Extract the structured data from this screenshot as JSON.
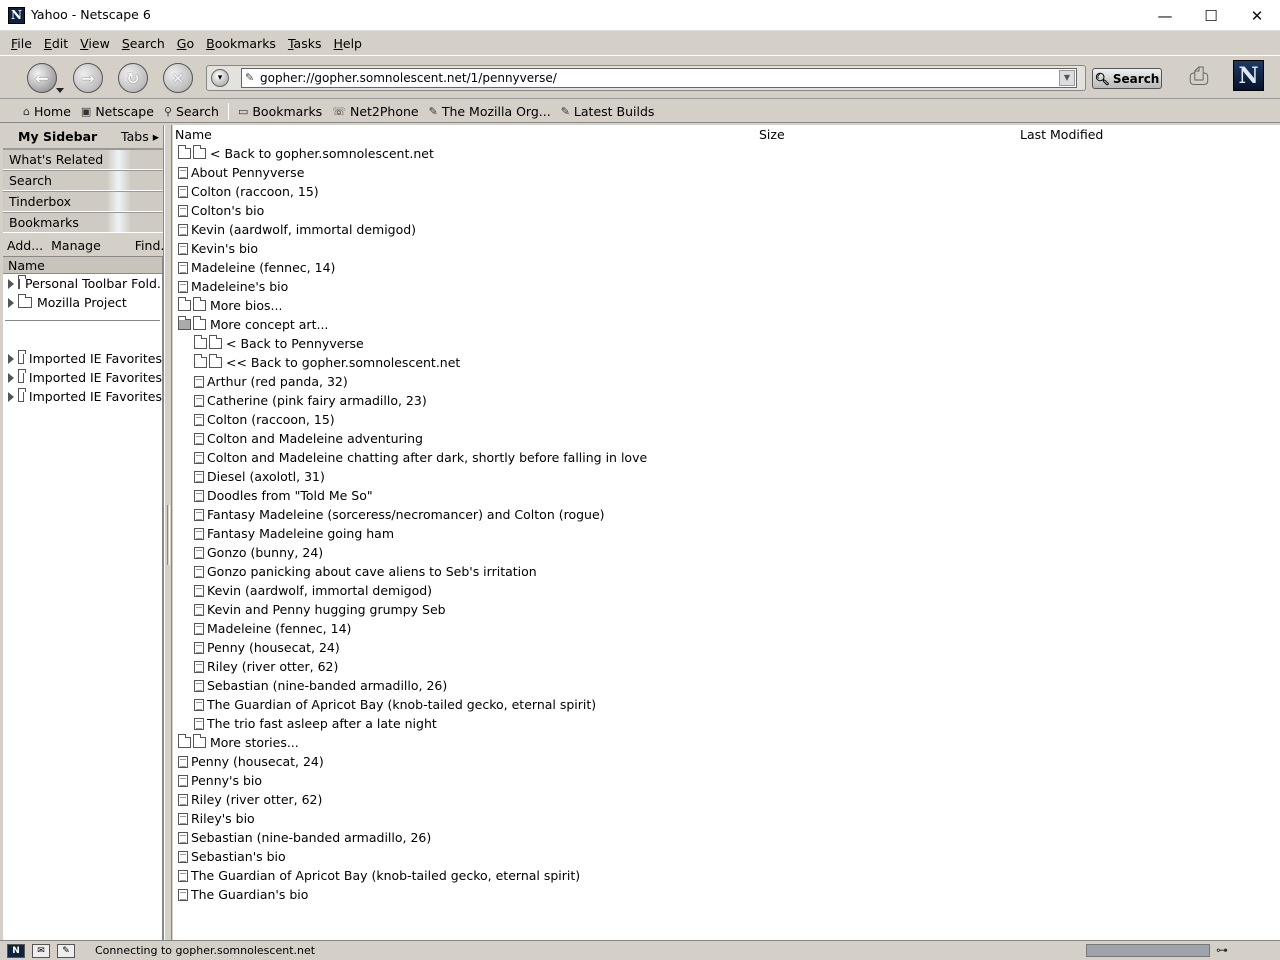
{
  "window": {
    "title": "Yahoo - Netscape 6",
    "minimize": "—",
    "maximize": "☐",
    "close": "✕"
  },
  "menubar": {
    "items": [
      "File",
      "Edit",
      "View",
      "Search",
      "Go",
      "Bookmarks",
      "Tasks",
      "Help"
    ]
  },
  "navbar": {
    "back": "←",
    "forward": "→",
    "reload": "↻",
    "stop": "✕",
    "url": "gopher://gopher.somnolescent.net/1/pennyverse/",
    "search_label": "Search",
    "logo": "N"
  },
  "personal_toolbar": {
    "items": [
      {
        "label": "Home",
        "icon": "home-icon"
      },
      {
        "label": "Netscape",
        "icon": "my-netscape-icon"
      },
      {
        "label": "Search",
        "icon": "search-icon"
      },
      {
        "label": "Bookmarks",
        "icon": "bookmarks-icon"
      },
      {
        "label": "Net2Phone",
        "icon": "phone-icon"
      },
      {
        "label": "The Mozilla Org...",
        "icon": "bookmark-link-icon"
      },
      {
        "label": "Latest Builds",
        "icon": "bookmark-link-icon"
      }
    ]
  },
  "sidebar": {
    "title": "My Sidebar",
    "tabs_label": "Tabs",
    "panels": [
      "What's Related",
      "Search",
      "Tinderbox",
      "Bookmarks"
    ],
    "actions": {
      "add": "Add...",
      "manage": "Manage",
      "find": "Find..."
    },
    "column": "Name",
    "tree_top": [
      "Personal Toolbar Fold...",
      "Mozilla Project"
    ],
    "tree_bottom": [
      "Imported IE Favorites",
      "Imported IE Favorites",
      "Imported IE Favorites"
    ]
  },
  "listing": {
    "columns": {
      "name": "Name",
      "size": "Size",
      "modified": "Last Modified"
    },
    "rows": [
      {
        "label": "< Back to gopher.somnolescent.net",
        "type": "dir",
        "indent": 0
      },
      {
        "label": "About Pennyverse",
        "type": "doc",
        "indent": 0
      },
      {
        "label": "Colton (raccoon, 15)",
        "type": "doc",
        "indent": 0
      },
      {
        "label": "Colton's bio",
        "type": "doc",
        "indent": 0
      },
      {
        "label": "Kevin (aardwolf, immortal demigod)",
        "type": "doc",
        "indent": 0
      },
      {
        "label": "Kevin's bio",
        "type": "doc",
        "indent": 0
      },
      {
        "label": "Madeleine (fennec, 14)",
        "type": "doc",
        "indent": 0
      },
      {
        "label": "Madeleine's bio",
        "type": "doc",
        "indent": 0
      },
      {
        "label": "More bios...",
        "type": "dir",
        "indent": 0
      },
      {
        "label": "More concept art...",
        "type": "dir-open",
        "indent": 0
      },
      {
        "label": "< Back to Pennyverse",
        "type": "dir",
        "indent": 1
      },
      {
        "label": "<< Back to gopher.somnolescent.net",
        "type": "dir",
        "indent": 1
      },
      {
        "label": "Arthur (red panda, 32)",
        "type": "doc",
        "indent": 1
      },
      {
        "label": "Catherine (pink fairy armadillo, 23)",
        "type": "doc",
        "indent": 1
      },
      {
        "label": "Colton (raccoon, 15)",
        "type": "doc",
        "indent": 1
      },
      {
        "label": "Colton and Madeleine adventuring",
        "type": "doc",
        "indent": 1
      },
      {
        "label": "Colton and Madeleine chatting after dark, shortly before falling in love",
        "type": "doc",
        "indent": 1
      },
      {
        "label": "Diesel (axolotl, 31)",
        "type": "doc",
        "indent": 1
      },
      {
        "label": "Doodles from \"Told Me So\"",
        "type": "doc",
        "indent": 1
      },
      {
        "label": "Fantasy Madeleine (sorceress/necromancer) and Colton (rogue)",
        "type": "doc",
        "indent": 1
      },
      {
        "label": "Fantasy Madeleine going ham",
        "type": "doc",
        "indent": 1
      },
      {
        "label": "Gonzo (bunny, 24)",
        "type": "doc",
        "indent": 1
      },
      {
        "label": "Gonzo panicking about cave aliens to Seb's irritation",
        "type": "doc",
        "indent": 1
      },
      {
        "label": "Kevin (aardwolf, immortal demigod)",
        "type": "doc",
        "indent": 1
      },
      {
        "label": "Kevin and Penny hugging grumpy Seb",
        "type": "doc",
        "indent": 1
      },
      {
        "label": "Madeleine (fennec, 14)",
        "type": "doc",
        "indent": 1
      },
      {
        "label": "Penny (housecat, 24)",
        "type": "doc",
        "indent": 1
      },
      {
        "label": "Riley (river otter, 62)",
        "type": "doc",
        "indent": 1
      },
      {
        "label": "Sebastian (nine-banded armadillo, 26)",
        "type": "doc",
        "indent": 1
      },
      {
        "label": "The Guardian of Apricot Bay (knob-tailed gecko, eternal spirit)",
        "type": "doc",
        "indent": 1
      },
      {
        "label": "The trio fast asleep after a late night",
        "type": "doc",
        "indent": 1
      },
      {
        "label": "More stories...",
        "type": "dir",
        "indent": 0
      },
      {
        "label": "Penny (housecat, 24)",
        "type": "doc",
        "indent": 0
      },
      {
        "label": "Penny's bio",
        "type": "doc",
        "indent": 0
      },
      {
        "label": "Riley (river otter, 62)",
        "type": "doc",
        "indent": 0
      },
      {
        "label": "Riley's bio",
        "type": "doc",
        "indent": 0
      },
      {
        "label": "Sebastian (nine-banded armadillo, 26)",
        "type": "doc",
        "indent": 0
      },
      {
        "label": "Sebastian's bio",
        "type": "doc",
        "indent": 0
      },
      {
        "label": "The Guardian of Apricot Bay (knob-tailed gecko, eternal spirit)",
        "type": "doc",
        "indent": 0
      },
      {
        "label": "The Guardian's bio",
        "type": "doc",
        "indent": 0
      }
    ]
  },
  "status": {
    "text": "Connecting to gopher.somnolescent.net"
  }
}
